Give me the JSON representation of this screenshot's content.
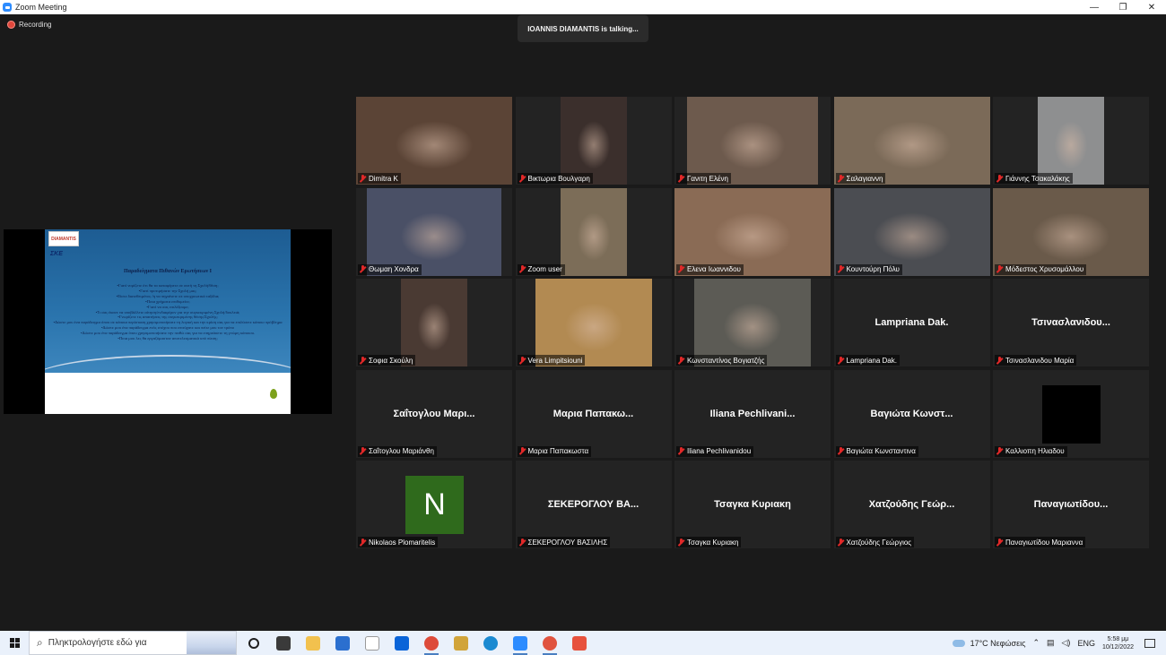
{
  "window": {
    "title": "Zoom Meeting",
    "minimize": "—",
    "restore": "❐",
    "close": "✕"
  },
  "recording": {
    "label": "Recording"
  },
  "talking": {
    "text": "IOANNIS DIAMANTIS is talking..."
  },
  "slide": {
    "logo_top": "DIAMANTIS",
    "logo_bottom": "ΣΚΕ",
    "title": "Παραδείγματα Πιθανών Ερωτήσεων Ι",
    "lines": [
      "•Γιατί νομίζετε ότι θα τα καταφέρετε σε αυτή τη Σχολή/θέση;",
      "•Γιατί προτιμήσατε την Σχολή μας;",
      "•Είστε διατεθειμένος /η να πηγαίνετε σε υποχρεωτικά ταξίδια;",
      "•Ποια χρήματα επιθυμείτε;",
      "•Γιατί να σας επιλέξουμε;",
      "•Τι σας έκανε να υποβάλλετε αίτηση/ενδιαφέρον για την συγκεκριμένη Σχολή/δουλειά;",
      "•Γνωρίζετε τις απαιτήσεις της συγκεκριμένης θέσης/Σχολής;",
      "•Δώστε μου ένα παράδειγμα όπου σε κάποια περίσταση χρησιμοποιήσατε τη λογική και την κρίση σας για να επιλύσετε κάποιο πρόβλημα",
      "•Δώστε μου ένα παράδειγμα ενός στόχου που επιτύχατε και πείτε μου τον τρόπο",
      "•Δώστε μου ένα παράδειγμα όπου χρησιμοποιήσατε την πειθώ σας για να επηρεάσετε τη γνώμη κάποιου.",
      "•Ποια μου λες θα εργαζόμασταν αποτελεσματικά υπό πίεση;"
    ]
  },
  "participants": [
    {
      "label": "Dimitra K",
      "type": "video",
      "video_color": "#5b4436"
    },
    {
      "label": "Βικτωρια Βουλγαρη",
      "type": "video",
      "video_color": "#3b2f2c"
    },
    {
      "label": "Γανιτη Ελένη",
      "type": "video",
      "video_color": "#6d5a4d"
    },
    {
      "label": "Σαλαγιαννη",
      "type": "video",
      "video_color": "#7b6a58"
    },
    {
      "label": "Γιάννης Τσακαλάκης",
      "type": "video",
      "video_color": "#8e8f90"
    },
    {
      "label": "Θωμαη Χονδρα",
      "type": "video",
      "video_color": "#4a5066"
    },
    {
      "label": "Zoom user",
      "type": "video",
      "video_color": "#7c6d58"
    },
    {
      "label": "Ελενα Ιωαννιδου",
      "type": "video",
      "video_color": "#8a6b55"
    },
    {
      "label": "Κουντούρη Πόλυ",
      "type": "video",
      "video_color": "#4b4d52"
    },
    {
      "label": "Μόδεστος Χρυσομάλλου",
      "type": "video",
      "video_color": "#6a5a4a"
    },
    {
      "label": "Σοφια Σκούλη",
      "type": "video",
      "video_color": "#4a3a33"
    },
    {
      "label": "Vera Limpitsiouni",
      "type": "video",
      "video_color": "#b28a52"
    },
    {
      "label": "Κωνσταντίνος Βογιατζής",
      "type": "video",
      "video_color": "#5c5b55"
    },
    {
      "label": "Lampriana Dak.",
      "type": "name",
      "display": "Lampriana Dak."
    },
    {
      "label": "Τσινασλανιδου Μαρία",
      "type": "name",
      "display": "Τσινασλανιδου..."
    },
    {
      "label": "Σαΐτογλου Μαριάνθη",
      "type": "name",
      "display": "Σαΐτογλου Μαρι..."
    },
    {
      "label": "Μαρια Παπακωστα",
      "type": "name",
      "display": "Μαρια Παπακω..."
    },
    {
      "label": "Iliana Pechlivanidou",
      "type": "name",
      "display": "Iliana Pechlivani..."
    },
    {
      "label": "Βαγιώτα Κωνσταντινα",
      "type": "name",
      "display": "Βαγιώτα Κωνστ..."
    },
    {
      "label": "Καλλιοπη Ηλιαδου",
      "type": "black"
    },
    {
      "label": "Nikolaos Plomaritelis",
      "type": "avatar",
      "initial": "N"
    },
    {
      "label": "ΣΕΚΕΡΟΓΛΟΥ ΒΑΣΙΛΗΣ",
      "type": "name",
      "display": "ΣΕΚΕΡΟΓΛΟΥ ΒΑ..."
    },
    {
      "label": "Τσαγκα Κυριακη",
      "type": "name",
      "display": "Τσαγκα Κυριακη"
    },
    {
      "label": "Χατζούδης Γεώργιος",
      "type": "name",
      "display": "Χατζούδης Γεώρ..."
    },
    {
      "label": "Παναγιωτίδου Μαριαννα",
      "type": "name",
      "display": "Παναγιωτίδου..."
    }
  ],
  "taskbar": {
    "search_placeholder": "Πληκτρολογήστε εδώ για",
    "apps": [
      {
        "name": "cortana-icon",
        "color": "#1f1f1f"
      },
      {
        "name": "task-view-icon",
        "color": "#3a3a3a"
      },
      {
        "name": "file-explorer-icon",
        "color": "#f2c14e"
      },
      {
        "name": "store-icon",
        "color": "#2b6fcf"
      },
      {
        "name": "amazon-icon",
        "color": "#ffffff"
      },
      {
        "name": "dropbox-icon",
        "color": "#0a64d8"
      },
      {
        "name": "chrome-icon",
        "color": "#dd4b3a"
      },
      {
        "name": "tool-icon",
        "color": "#d1a43a"
      },
      {
        "name": "edge-icon",
        "color": "#1b8ad1"
      },
      {
        "name": "zoom-icon",
        "color": "#2d8cff"
      },
      {
        "name": "chrome-profile-icon",
        "color": "#e0533f"
      },
      {
        "name": "paint-icon",
        "color": "#e7523d"
      }
    ],
    "weather": "17°C Νεφώσεις",
    "lang": "ENG",
    "time": "5:58 μμ",
    "date": "10/12/2022"
  }
}
